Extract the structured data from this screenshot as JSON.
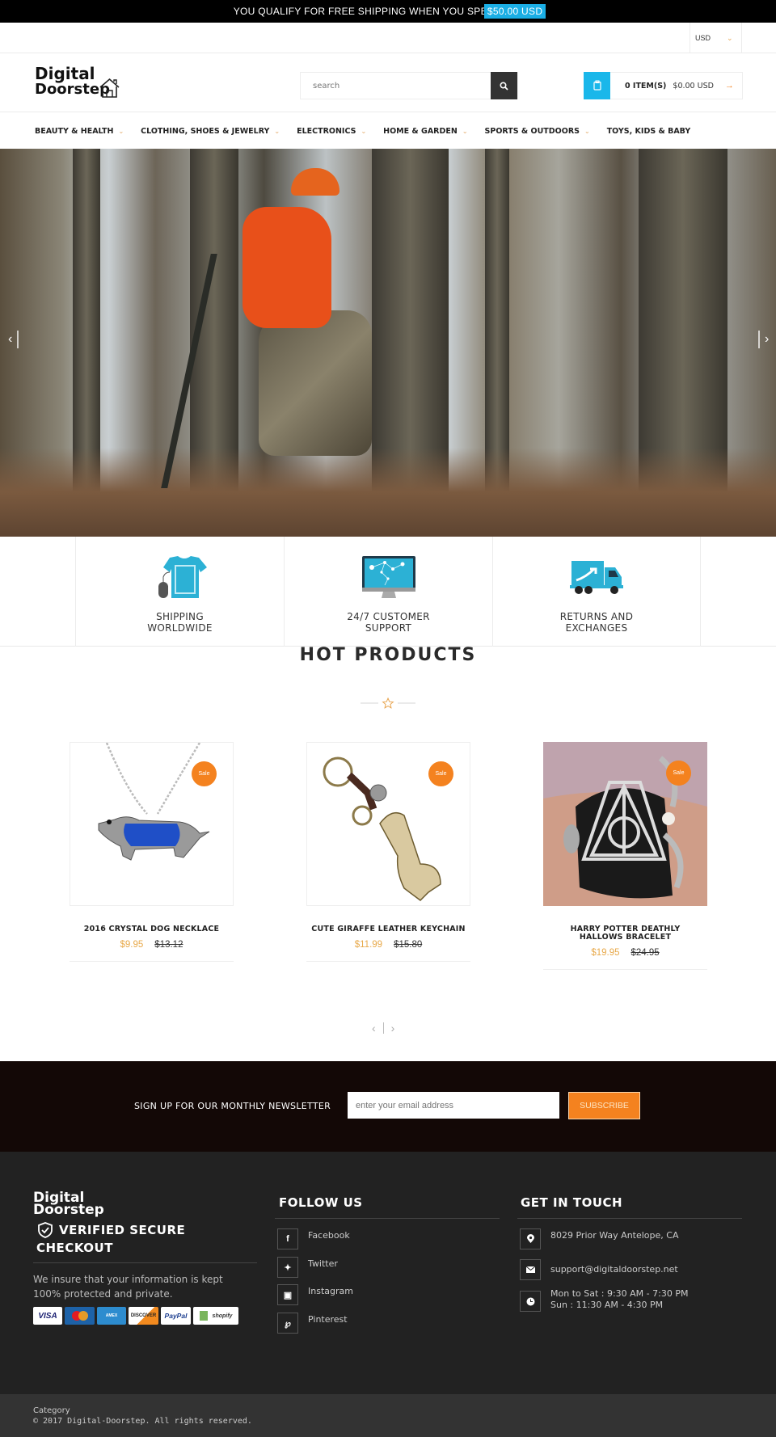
{
  "announcement": {
    "text": "YOU QUALIFY FOR FREE SHIPPING WHEN YOU SPE",
    "highlight": "$50.00 USD",
    "highlight_color": "#1aaee5"
  },
  "topbar": {
    "currency": "USD"
  },
  "header": {
    "logo_line1": "Digital",
    "logo_line2": "Doorstep",
    "search_placeholder": "search",
    "cart_count": "0 ITEM(S)",
    "cart_total": "$0.00 USD",
    "cart_color": "#1ab7ea"
  },
  "nav": {
    "items": [
      {
        "label": "BEAUTY & HEALTH",
        "has_dropdown": true
      },
      {
        "label": "CLOTHING, SHOES & JEWELRY",
        "has_dropdown": true
      },
      {
        "label": "ELECTRONICS",
        "has_dropdown": true
      },
      {
        "label": "HOME & GARDEN",
        "has_dropdown": true
      },
      {
        "label": "SPORTS & OUTDOORS",
        "has_dropdown": true
      },
      {
        "label": "TOYS, KIDS & BABY",
        "has_dropdown": false
      }
    ]
  },
  "hero": {
    "description": "Hunter in orange vest on tree stand in forest"
  },
  "features": [
    {
      "icon": "tshirt-icon",
      "line1": "SHIPPING",
      "line2": "WORLDWIDE"
    },
    {
      "icon": "monitor-network-icon",
      "line1": "24/7 CUSTOMER",
      "line2": "SUPPORT"
    },
    {
      "icon": "truck-icon",
      "line1": "RETURNS AND",
      "line2": "EXCHANGES"
    }
  ],
  "hot_products": {
    "title": "HOT PRODUCTS",
    "sale_badge": "Sale",
    "items": [
      {
        "name": "2016 CRYSTAL DOG NECKLACE",
        "price": "$9.95",
        "compare_price": "$13.12"
      },
      {
        "name": "CUTE GIRAFFE LEATHER KEYCHAIN",
        "price": "$11.99",
        "compare_price": "$15.80"
      },
      {
        "name": "HARRY POTTER DEATHLY HALLOWS BRACELET",
        "price": "$19.95",
        "compare_price": "$24.95"
      }
    ]
  },
  "newsletter": {
    "label": "SIGN UP FOR OUR MONTHLY NEWSLETTER",
    "placeholder": "enter your email address",
    "button": "SUBSCRIBE"
  },
  "footer": {
    "logo_line1": "Digital",
    "logo_line2": "Doorstep",
    "secure_line1": "VERIFIED SECURE",
    "secure_line2": "CHECKOUT",
    "insure_text": "We insure that your information is kept 100% protected and private.",
    "payment_cards": [
      "VISA",
      "MasterCard",
      "American Express",
      "DISCOVER",
      "PayPal",
      "shopify SECURE"
    ],
    "follow_title": "FOLLOW US",
    "social": [
      {
        "icon": "facebook-icon",
        "label": "Facebook"
      },
      {
        "icon": "twitter-icon",
        "label": "Twitter"
      },
      {
        "icon": "instagram-icon",
        "label": "Instagram"
      },
      {
        "icon": "pinterest-icon",
        "label": "Pinterest"
      }
    ],
    "touch_title": "GET IN TOUCH",
    "address": "8029 Prior Way Antelope, CA",
    "email": "support@digitaldoorstep.net",
    "hours_line1": "Mon to Sat : 9:30 AM - 7:30 PM",
    "hours_line2": "Sun : 11:30 AM - 4:30 PM"
  },
  "bottom": {
    "category": "Category",
    "copyright": "© 2017 Digital-Doorstep. All rights reserved."
  }
}
